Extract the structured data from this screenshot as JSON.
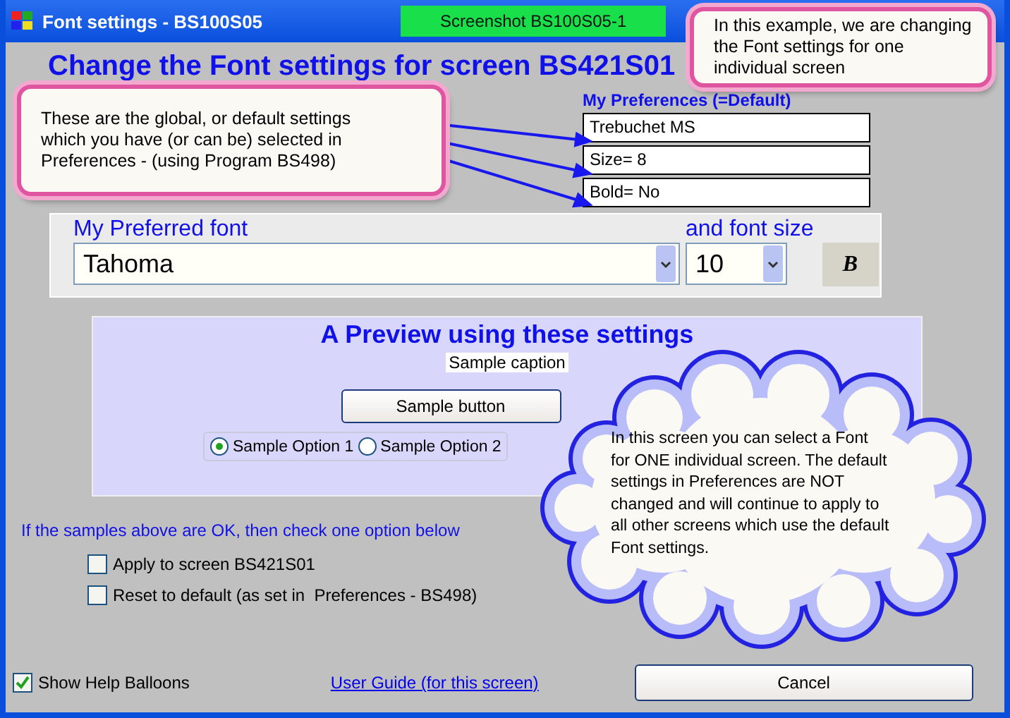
{
  "window": {
    "title": "Font settings - BS100S05",
    "badge": "Screenshot BS100S05-1"
  },
  "heading": "Change the Font settings for screen BS421S01",
  "preferences": {
    "title": "My Preferences (=Default)",
    "values": [
      "Trebuchet MS",
      "Size= 8",
      "Bold= No"
    ]
  },
  "font_panel": {
    "font_label": "My Preferred font",
    "font_value": "Tahoma",
    "size_label": "and font size",
    "size_value": "10",
    "bold_button": "B"
  },
  "preview": {
    "title": "A Preview using these settings",
    "caption": "Sample caption",
    "button": "Sample button",
    "options": [
      {
        "label": "Sample Option 1",
        "selected": true
      },
      {
        "label": "Sample Option 2",
        "selected": false
      }
    ]
  },
  "instruction": "If the samples above are OK, then check one option below",
  "options": [
    {
      "label": "Apply to screen BS421S01",
      "checked": false
    },
    {
      "label": "Reset to default (as set in  Preferences - BS498)",
      "checked": false
    }
  ],
  "show_help": {
    "label": "Show Help Balloons",
    "checked": true
  },
  "link": "User Guide (for this screen)",
  "cancel": "Cancel",
  "callouts": [
    {
      "kind": "box",
      "text": "In this example, we are changing the Font settings for one individual screen"
    },
    {
      "kind": "box",
      "text": "These are the global, or default settings which you have (or can be) selected in Preferences - (using Program BS498)"
    },
    {
      "kind": "cloud",
      "text": "In this screen you can select a Font for ONE individual screen. The default settings in Preferences are NOT changed and will continue to apply to all other screens which use the default Font settings."
    }
  ]
}
